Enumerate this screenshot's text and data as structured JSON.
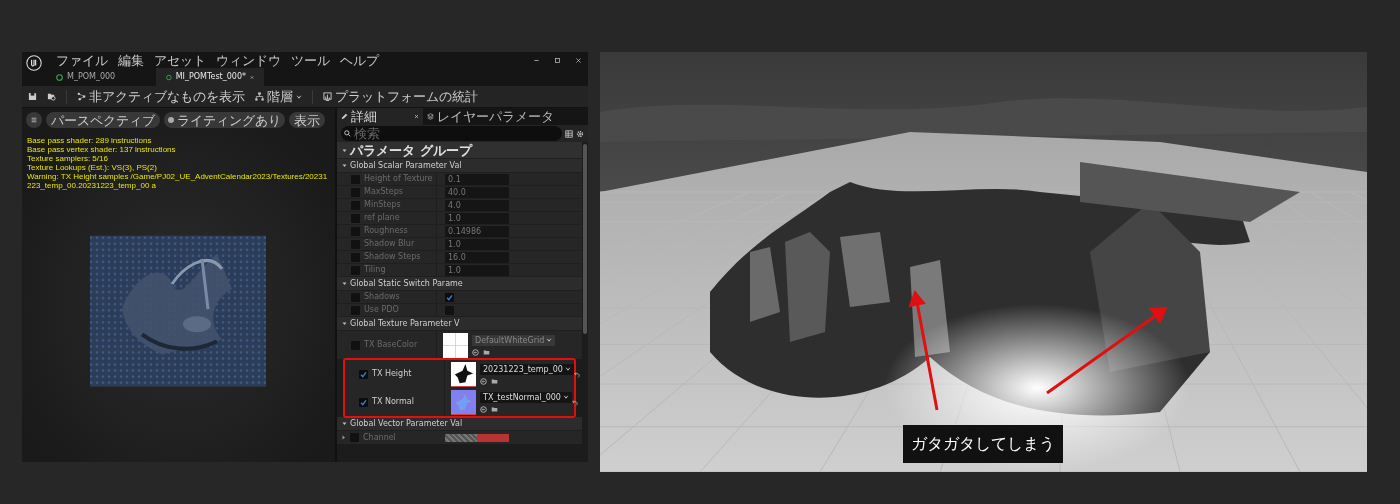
{
  "editor": {
    "menu": [
      "ファイル",
      "編集",
      "アセット",
      "ウィンドウ",
      "ツール",
      "ヘルプ"
    ],
    "tabs": [
      {
        "label": "M_POM_000",
        "selected": false
      },
      {
        "label": "MI_POMTest_000*",
        "selected": true
      }
    ],
    "toolbar": [
      {
        "kind": "show",
        "label": "非アクティブなものを表示"
      },
      {
        "kind": "hierarchy",
        "label": "階層"
      },
      {
        "kind": "stats",
        "label": "プラットフォームの統計"
      }
    ],
    "viewport": {
      "buttons": [
        {
          "kind": "menu"
        },
        {
          "kind": "text",
          "label": "パースペクティブ"
        },
        {
          "kind": "lit",
          "label": "ライティングあり"
        },
        {
          "kind": "text",
          "label": "表示"
        }
      ],
      "stats": [
        "Base pass shader: 289 instructions",
        "Base pass vertex shader: 137 instructions",
        "Texture samplers: 5/16",
        "Texture Lookups (Est.): VS(3), PS(2)",
        "Warning: TX Height samples /Game/PJ02_UE_AdventCalendar2023/Textures/20231223_temp_00.20231223_temp_00 a"
      ]
    }
  },
  "details": {
    "tabs": [
      {
        "label": "詳細",
        "selected": true
      },
      {
        "label": "レイヤーパラメータ",
        "selected": false
      }
    ],
    "search": {
      "placeholder": "検索"
    },
    "root": "パラメータ グループ",
    "groups": [
      {
        "title": "Global Scalar Parameter Val",
        "params": [
          {
            "kind": "scalar",
            "name": "Height of Texture",
            "enabled": false,
            "value": "0.1"
          },
          {
            "kind": "scalar",
            "name": "MaxSteps",
            "enabled": false,
            "value": "40.0"
          },
          {
            "kind": "scalar",
            "name": "MinSteps",
            "enabled": false,
            "value": "4.0"
          },
          {
            "kind": "scalar",
            "name": "ref plane",
            "enabled": false,
            "value": "1.0"
          },
          {
            "kind": "scalar",
            "name": "Roughness",
            "enabled": false,
            "value": "0.14986"
          },
          {
            "kind": "scalar",
            "name": "Shadow Blur",
            "enabled": false,
            "value": "1.0"
          },
          {
            "kind": "scalar",
            "name": "Shadow Steps",
            "enabled": false,
            "value": "16.0"
          },
          {
            "kind": "scalar",
            "name": "Tiling",
            "enabled": false,
            "value": "1.0"
          }
        ]
      },
      {
        "title": "Global Static Switch Parame",
        "params": [
          {
            "kind": "switch",
            "name": "Shadows",
            "enabled": false,
            "checked": true
          },
          {
            "kind": "switch",
            "name": "Use PDO",
            "enabled": false,
            "checked": false
          }
        ]
      },
      {
        "title": "Global Texture Parameter V",
        "params": [
          {
            "kind": "texture",
            "name": "TX BaseColor",
            "enabled": false,
            "asset": "DefaultWhiteGrid",
            "highlighted": false
          },
          {
            "kind": "texture",
            "name": "TX Height",
            "enabled": true,
            "asset": "20231223_temp_00",
            "highlighted": true
          },
          {
            "kind": "texture",
            "name": "TX Normal",
            "enabled": true,
            "asset": "TX_testNormal_000",
            "highlighted": true
          }
        ]
      },
      {
        "title": "Global Vector Parameter Val",
        "params": [
          {
            "kind": "vector",
            "name": "Channel",
            "enabled": false,
            "color": "#b83434"
          }
        ]
      }
    ]
  },
  "render": {
    "caption": "ガタガタしてしまう"
  }
}
